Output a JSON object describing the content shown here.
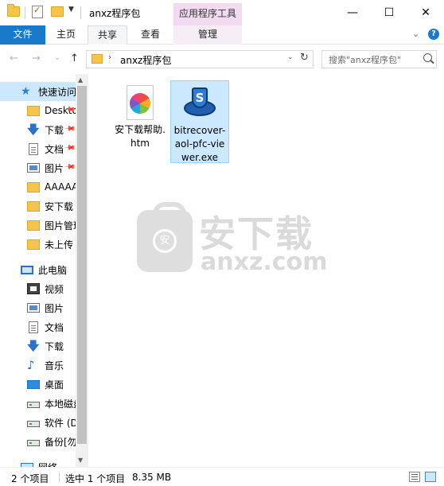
{
  "window": {
    "title": "anxz程序包",
    "context_tab_group": "应用程序工具",
    "minimize_glyph": "—",
    "maximize_glyph": "☐",
    "close_glyph": "✕"
  },
  "ribbon": {
    "tabs": [
      "文件",
      "主页",
      "共享",
      "查看",
      "管理"
    ],
    "expand_glyph": "⌄",
    "help_glyph": "?"
  },
  "navigation": {
    "back_glyph": "←",
    "forward_glyph": "→",
    "recent_glyph": "⌄",
    "up_glyph": "↑",
    "address_path": "anxz程序包",
    "address_chevron": "›",
    "address_dropdown_glyph": "⌄",
    "refresh_glyph": "↻",
    "search_placeholder": "搜索\"anxz程序包\""
  },
  "sidebar": {
    "items": [
      {
        "label": "快速访问",
        "icon": "star-icon",
        "pinned": false,
        "selected": true
      },
      {
        "label": "Desktop",
        "icon": "folder-icon",
        "pinned": true
      },
      {
        "label": "下载",
        "icon": "download-icon",
        "pinned": true
      },
      {
        "label": "文档",
        "icon": "document-icon",
        "pinned": true
      },
      {
        "label": "图片",
        "icon": "picture-icon",
        "pinned": true
      },
      {
        "label": "AAAAA",
        "icon": "folder-icon",
        "pinned": false
      },
      {
        "label": "安下载",
        "icon": "folder-icon",
        "pinned": false
      },
      {
        "label": "图片管理",
        "icon": "folder-icon",
        "pinned": false
      },
      {
        "label": "未上传",
        "icon": "folder-icon",
        "pinned": false
      },
      {
        "label": "此电脑",
        "icon": "pc-icon",
        "pinned": false
      },
      {
        "label": "视频",
        "icon": "video-icon",
        "pinned": false
      },
      {
        "label": "图片",
        "icon": "picture-icon",
        "pinned": false
      },
      {
        "label": "文档",
        "icon": "document-icon",
        "pinned": false
      },
      {
        "label": "下载",
        "icon": "download-icon",
        "pinned": false
      },
      {
        "label": "音乐",
        "icon": "music-icon",
        "pinned": false
      },
      {
        "label": "桌面",
        "icon": "desktop-icon",
        "pinned": false
      },
      {
        "label": "本地磁盘",
        "icon": "drive-icon",
        "pinned": false
      },
      {
        "label": "软件 (D:)",
        "icon": "drive-icon",
        "pinned": false
      },
      {
        "label": "备份[勿",
        "icon": "drive-icon",
        "pinned": false
      },
      {
        "label": "网络",
        "icon": "network-icon",
        "pinned": false
      }
    ],
    "pin_glyph": "📌",
    "scroll_up_glyph": "▲",
    "scroll_down_glyph": "▼"
  },
  "files": [
    {
      "name": "安下载帮助.htm",
      "icon": "html-file-icon",
      "selected": false
    },
    {
      "name": "bitrecover-aol-pfc-viewer.exe",
      "icon": "exe-app-icon",
      "selected": true
    }
  ],
  "watermark": {
    "text": "安下载",
    "subtext": "anxz.com",
    "logo_char": "安"
  },
  "status": {
    "item_count": "2 个项目",
    "selection": "选中 1 个项目",
    "size": "8.35 MB"
  }
}
